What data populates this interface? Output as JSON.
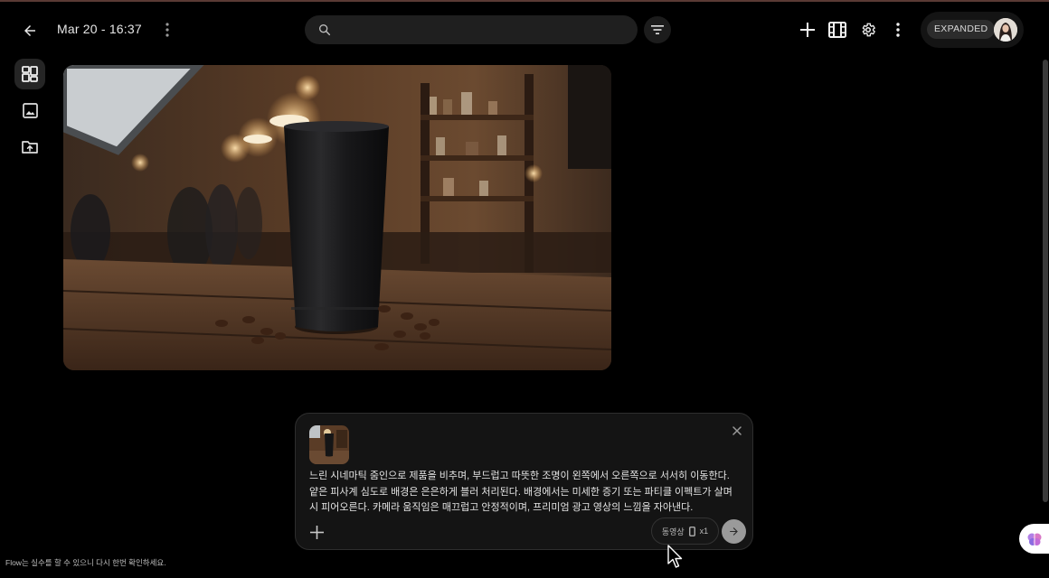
{
  "header": {
    "back_icon": "arrow-left-icon",
    "title": "Mar 20 - 16:37",
    "menu_icon": "more-vert-icon",
    "search": {
      "value": "",
      "placeholder": ""
    },
    "filter_icon": "filter-list-icon",
    "actions": [
      "add-icon",
      "film-icon",
      "settings-icon",
      "more-vert-icon"
    ],
    "profile": {
      "badge": "EXPANDED"
    }
  },
  "sidebar": {
    "items": [
      {
        "icon": "grid-view-icon",
        "active": true
      },
      {
        "icon": "image-icon",
        "active": false
      },
      {
        "icon": "upload-folder-icon",
        "active": false
      }
    ]
  },
  "composer": {
    "prompt": "느린 시네마틱 줌인으로 제품을 비추며, 부드럽고 따뜻한 조명이 왼쪽에서 오른쪽으로 서서히 이동한다. 얕은 피사계 심도로 배경은 은은하게 블러 처리된다. 배경에서는 미세한 증기 또는 파티클 이펙트가 살며시 피어오른다. 카메라 움직임은 매끄럽고 안정적이며, 프리미엄 광고 영상의 느낌을 자아낸다.",
    "mode_label": "동영상",
    "count_label": "x1"
  },
  "footer": {
    "note": "Flow는 실수를 할 수 있으니 다시 한번 확인하세요."
  },
  "colors": {
    "background": "#000000",
    "surface": "#141414",
    "search_bg": "#1f1f1f",
    "send_button": "#9a9a9a"
  }
}
